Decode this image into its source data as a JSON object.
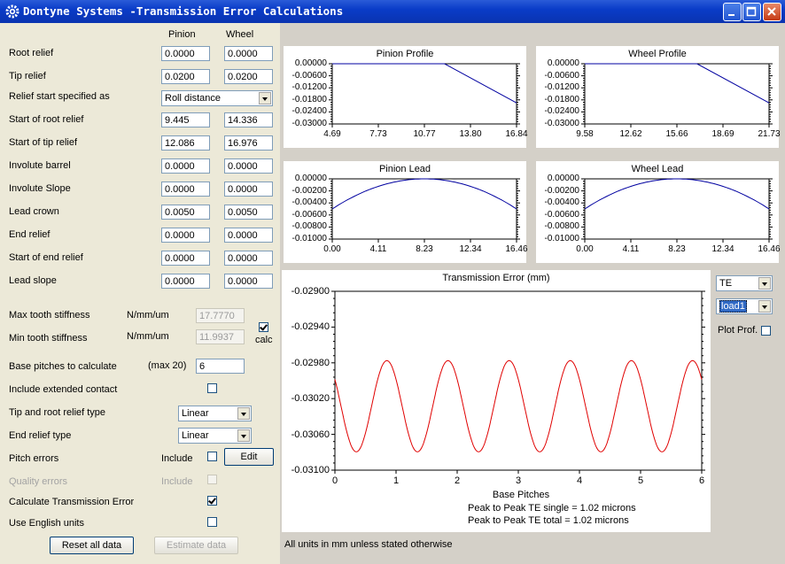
{
  "window": {
    "title": "Dontyne Systems -Transmission Error Calculations"
  },
  "columns": {
    "pinion": "Pinion",
    "wheel": "Wheel"
  },
  "rows": [
    {
      "label": "Root relief",
      "pinion": "0.0000",
      "wheel": "0.0000"
    },
    {
      "label": "Tip relief",
      "pinion": "0.0200",
      "wheel": "0.0200"
    },
    {
      "label": "Relief start specified as",
      "combo": "Roll distance"
    },
    {
      "label": "Start of root relief",
      "pinion": "9.445",
      "wheel": "14.336"
    },
    {
      "label": "Start of tip relief",
      "pinion": "12.086",
      "wheel": "16.976"
    },
    {
      "label": "Involute barrel",
      "pinion": "0.0000",
      "wheel": "0.0000"
    },
    {
      "label": "Involute Slope",
      "pinion": "0.0000",
      "wheel": "0.0000"
    },
    {
      "label": "Lead crown",
      "pinion": "0.0050",
      "wheel": "0.0050"
    },
    {
      "label": "End relief",
      "pinion": "0.0000",
      "wheel": "0.0000"
    },
    {
      "label": "Start of end relief",
      "pinion": "0.0000",
      "wheel": "0.0000"
    },
    {
      "label": "Lead slope",
      "pinion": "0.0000",
      "wheel": "0.0000"
    }
  ],
  "stiffness": {
    "max_label": "Max tooth stiffness",
    "min_label": "Min tooth stiffness",
    "unit": "N/mm/um",
    "max_value": "17.7770",
    "min_value": "11.9937",
    "calc_label": "calc",
    "calc_checked": true
  },
  "base_pitches": {
    "label": "Base pitches to calculate",
    "max_note": "(max  20)",
    "value": "6"
  },
  "extended_contact": {
    "label": "Include extended contact",
    "checked": false
  },
  "tip_root_type": {
    "label": "Tip and root relief type",
    "value": "Linear"
  },
  "end_relief_type": {
    "label": "End relief type",
    "value": "Linear"
  },
  "pitch_errors": {
    "label": "Pitch errors",
    "include": "Include",
    "edit": "Edit",
    "checked": false
  },
  "quality_errors": {
    "label": "Quality errors",
    "include": "Include",
    "checked": false
  },
  "calc_te": {
    "label": "Calculate Transmission Error",
    "checked": true
  },
  "english_units": {
    "label": "Use English units",
    "checked": false
  },
  "buttons": {
    "reset": "Reset all data",
    "estimate": "Estimate data"
  },
  "footer_note": "All units in mm unless stated otherwise",
  "side_controls": {
    "te_select": "TE",
    "load_select": "load1",
    "plot_prof_label": "Plot Prof."
  },
  "chart_data": [
    {
      "type": "line",
      "title": "Pinion Profile",
      "x_ticks": [
        "4.69",
        "7.73",
        "10.77",
        "13.80",
        "16.84"
      ],
      "y_ticks": [
        "0.00000",
        "-0.00600",
        "-0.01200",
        "-0.01800",
        "-0.02400",
        "-0.03000"
      ],
      "xlim": [
        4.69,
        16.84
      ],
      "ylim": [
        -0.03,
        0.0
      ],
      "series": [
        {
          "color": "#0000a0",
          "x": [
            4.69,
            12.09,
            16.84
          ],
          "y": [
            0.0,
            0.0,
            -0.0195
          ]
        }
      ]
    },
    {
      "type": "line",
      "title": "Wheel Profile",
      "x_ticks": [
        "9.58",
        "12.62",
        "15.66",
        "18.69",
        "21.73"
      ],
      "y_ticks": [
        "0.00000",
        "-0.00600",
        "-0.01200",
        "-0.01800",
        "-0.02400",
        "-0.03000"
      ],
      "xlim": [
        9.58,
        21.73
      ],
      "ylim": [
        -0.03,
        0.0
      ],
      "series": [
        {
          "color": "#0000a0",
          "x": [
            9.58,
            16.98,
            21.73
          ],
          "y": [
            0.0,
            0.0,
            -0.0195
          ]
        }
      ]
    },
    {
      "type": "line",
      "title": "Pinion Lead",
      "x_ticks": [
        "0.00",
        "4.11",
        "8.23",
        "12.34",
        "16.46"
      ],
      "y_ticks": [
        "0.00000",
        "-0.00200",
        "-0.00400",
        "-0.00600",
        "-0.00800",
        "-0.01000"
      ],
      "xlim": [
        0.0,
        16.46
      ],
      "ylim": [
        -0.01,
        0.0
      ],
      "series": [
        {
          "color": "#0000a0",
          "curve": "crown",
          "crown": 0.005
        }
      ]
    },
    {
      "type": "line",
      "title": "Wheel Lead",
      "x_ticks": [
        "0.00",
        "4.11",
        "8.23",
        "12.34",
        "16.46"
      ],
      "y_ticks": [
        "0.00000",
        "-0.00200",
        "-0.00400",
        "-0.00600",
        "-0.00800",
        "-0.01000"
      ],
      "xlim": [
        0.0,
        16.46
      ],
      "ylim": [
        -0.01,
        0.0
      ],
      "series": [
        {
          "color": "#0000a0",
          "curve": "crown",
          "crown": 0.005
        }
      ]
    },
    {
      "type": "line",
      "title": "Transmission Error (mm)",
      "xlabel": "Base Pitches",
      "x_ticks": [
        "0",
        "1",
        "2",
        "3",
        "4",
        "5",
        "6"
      ],
      "y_ticks": [
        "-0.02900",
        "-0.02940",
        "-0.02980",
        "-0.03020",
        "-0.03060",
        "-0.03100"
      ],
      "xlim": [
        0,
        6
      ],
      "ylim": [
        -0.031,
        -0.029
      ],
      "series": [
        {
          "color": "#e00000",
          "curve": "periodic",
          "mean": -0.030285,
          "amplitude": 0.00051,
          "phase_peak": 0.85
        }
      ],
      "annotations": [
        "Peak to Peak TE single =   1.02 microns",
        "Peak to Peak TE total =   1.02 microns"
      ]
    }
  ]
}
